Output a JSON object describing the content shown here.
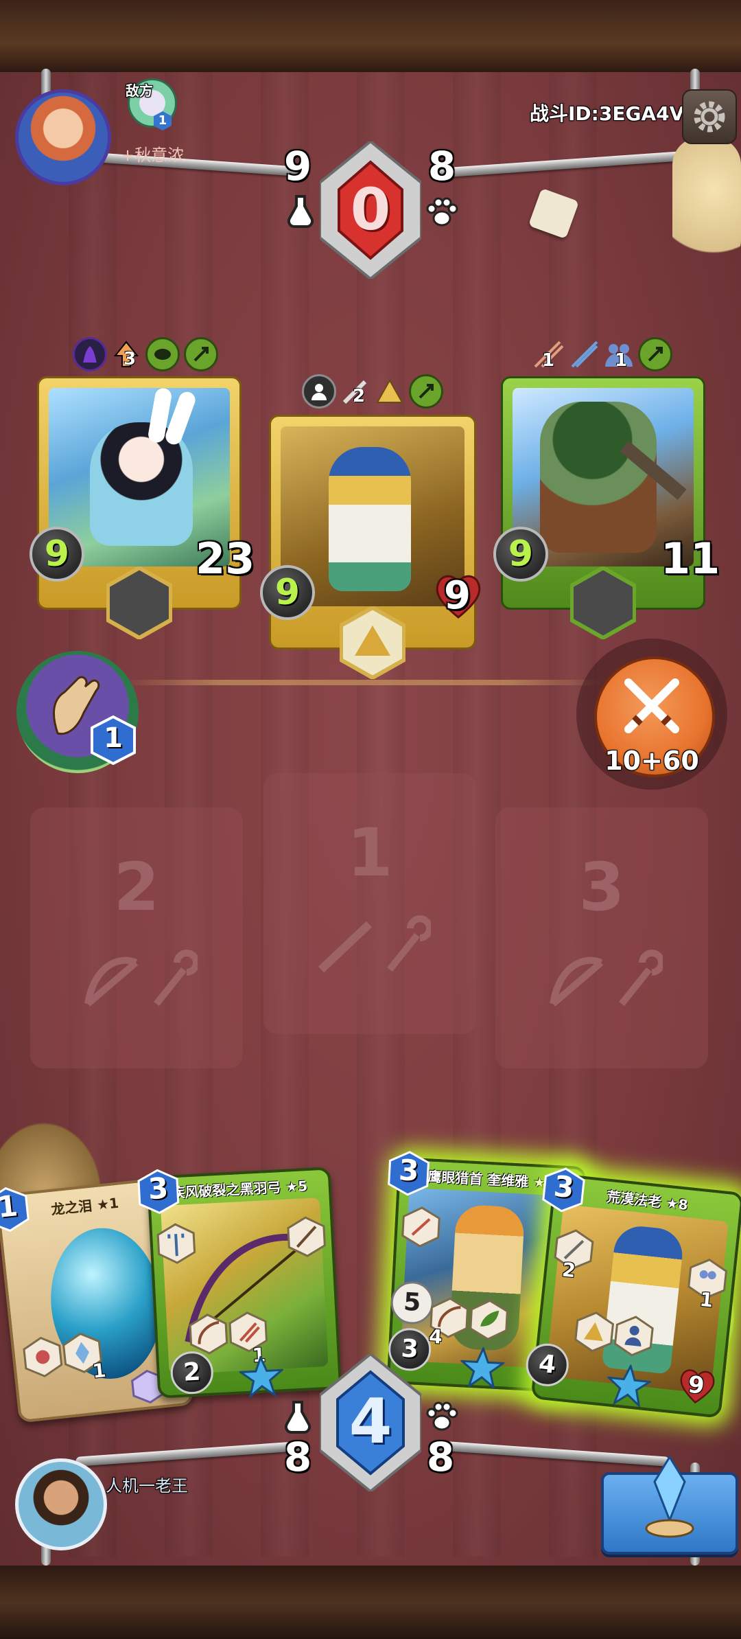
{
  "battle": {
    "id_label": "战斗ID:3EGA4V"
  },
  "enemy": {
    "tag": "敌方",
    "name": "+秋意浓",
    "level_badge": "1",
    "stat_left": "9",
    "stat_right": "8",
    "energy": "0"
  },
  "player": {
    "name": "人机一老王",
    "stat_left": "8",
    "stat_right": "8",
    "energy": "4"
  },
  "enemy_cards": [
    {
      "name": "rabbit-archer",
      "attack": "9",
      "hp": "23",
      "trait_count": "3"
    },
    {
      "name": "pharaoh",
      "attack": "9",
      "hp": "9",
      "trait_count": "2"
    },
    {
      "name": "hunter",
      "attack": "9",
      "hp": "11",
      "trait_left": "1",
      "trait_right": "1"
    }
  ],
  "skill": {
    "cost": "1"
  },
  "attack_button": {
    "label": "10+60"
  },
  "slots": [
    {
      "number": "2"
    },
    {
      "number": "1"
    },
    {
      "number": "3"
    }
  ],
  "hand": [
    {
      "title": "龙之泪 ★1",
      "cost": "1",
      "stat": "1"
    },
    {
      "title": "疾风破裂之黑羽弓 ★5",
      "cost": "3",
      "stat": "1",
      "bottom": "2"
    },
    {
      "title": "鹰眼猎首 奎维雅 ★8",
      "cost": "3",
      "left_a": "5",
      "left_b": "3",
      "stat": "4"
    },
    {
      "title": "荒漠法老 ★8",
      "cost": "3",
      "left": "4",
      "stat": "2",
      "stat2": "1",
      "hp": "9"
    }
  ],
  "colors": {
    "board": "#7b3d40",
    "gold_frame": "#d9b43a",
    "green_frame": "#6aa62a",
    "attack_green": "#b8f24a",
    "attack_orange": "#e8742e",
    "energy_red": "#d8322f",
    "energy_blue": "#3a7fd8"
  }
}
